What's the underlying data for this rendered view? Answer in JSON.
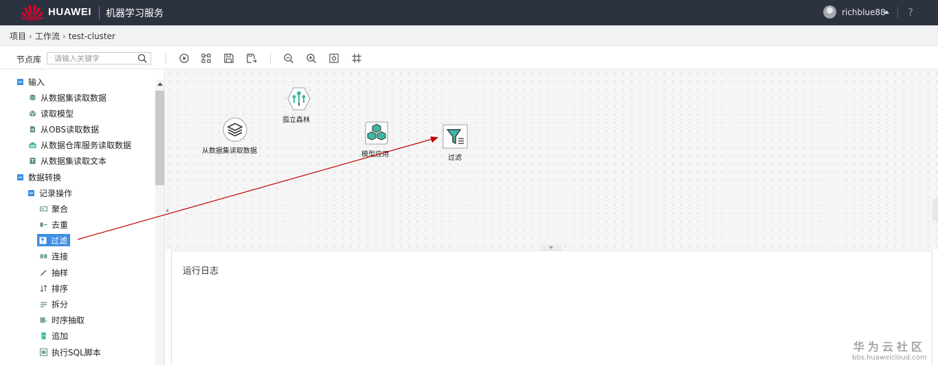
{
  "header": {
    "brand": "HUAWEI",
    "service": "机器学习服务",
    "username": "richblue88",
    "help": "?"
  },
  "breadcrumb": {
    "items": [
      "项目",
      "工作流",
      "test-cluster"
    ]
  },
  "toolbar": {
    "node_library_label": "节点库",
    "search_placeholder": "请输入关键字",
    "tools": [
      "run-icon",
      "layout-icon",
      "save-icon",
      "save-as-icon",
      "zoom-out-icon",
      "zoom-in-icon",
      "fit-icon",
      "grid-icon"
    ]
  },
  "tree": {
    "input_group": "输入",
    "input_items": [
      "从数据集读取数据",
      "读取模型",
      "从OBS读取数据",
      "从数据仓库服务读取数据",
      "从数据集读取文本"
    ],
    "transform_group": "数据转换",
    "record_ops_group": "记录操作",
    "record_ops_items": [
      "聚合",
      "去重",
      "过滤",
      "连接",
      "抽样",
      "排序",
      "拆分",
      "时序抽取",
      "追加",
      "执行SQL脚本"
    ],
    "selected_item": "过滤"
  },
  "canvas": {
    "nodes": [
      {
        "label": "孤立森林",
        "icon": "isolation-forest-icon"
      },
      {
        "label": "从数据集读取数据",
        "icon": "dataset-icon"
      },
      {
        "label": "模型应用",
        "icon": "model-apply-icon"
      },
      {
        "label": "过滤",
        "icon": "filter-icon"
      }
    ]
  },
  "log": {
    "title": "运行日志"
  },
  "watermark": {
    "line1": "华为云社区",
    "line2": "bbs.huaweicloud.com"
  },
  "colors": {
    "topbar": "#2c3240",
    "accent": "#3b8ee3",
    "node_teal": "#3fb8a6",
    "arrow": "#c00000",
    "huawei_red": "#e4002b"
  }
}
